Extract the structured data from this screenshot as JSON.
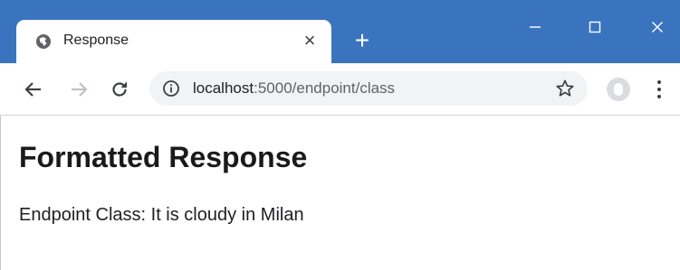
{
  "browser": {
    "tab": {
      "title": "Response",
      "favicon": "globe-icon",
      "close_glyph": "×"
    },
    "new_tab_glyph": "+",
    "window_controls": [
      "minimize-icon",
      "maximize-icon",
      "close-icon"
    ],
    "toolbar": {
      "icons": [
        "arrow-left-icon",
        "arrow-right-icon",
        "reload-icon"
      ],
      "url_host": "localhost",
      "url_rest": ":5000/endpoint/class",
      "site_info_icon": "info-icon",
      "bookmark_icon": "star-icon",
      "profile_icon": "profile-icon",
      "menu_icon": "kebab-menu-icon"
    },
    "colors": {
      "titlebar": "#3a74bf",
      "omnibox": "#f1f3f4"
    }
  },
  "page": {
    "heading": "Formatted Response",
    "body": "Endpoint Class: It is cloudy in Milan"
  }
}
